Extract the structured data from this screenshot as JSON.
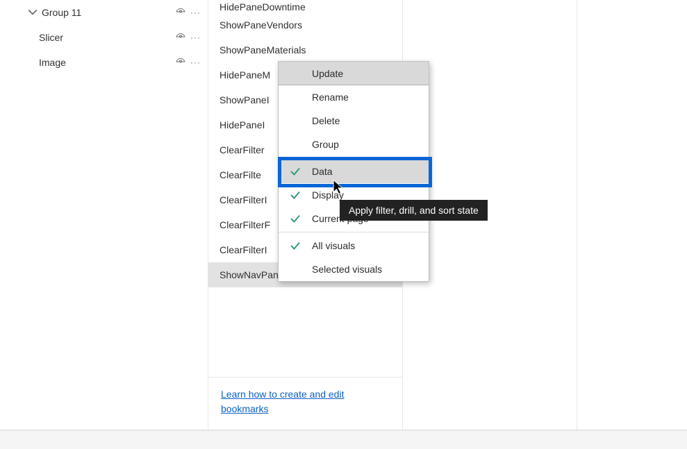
{
  "selection": {
    "items": [
      {
        "label": "Group 11",
        "expanded": true
      },
      {
        "label": "Slicer"
      },
      {
        "label": "Image"
      }
    ]
  },
  "bookmarks": {
    "items": [
      "HidePaneDowntime",
      "ShowPaneVendors",
      "ShowPaneMaterials",
      "HidePaneM",
      "ShowPaneI",
      "HidePaneI",
      "ClearFilter",
      "ClearFilte",
      "ClearFilterI",
      "ClearFilterF",
      "ClearFilterI",
      "ShowNavPanel"
    ],
    "learn_link": "Learn how to create and edit bookmarks"
  },
  "context_menu": {
    "items": [
      {
        "label": "Update"
      },
      {
        "label": "Rename"
      },
      {
        "label": "Delete"
      },
      {
        "label": "Group"
      }
    ],
    "check_items_1": [
      {
        "label": "Data",
        "checked": true,
        "hovered": true
      },
      {
        "label": "Display",
        "checked": true
      },
      {
        "label": "Current page",
        "checked": true
      }
    ],
    "check_items_2": [
      {
        "label": "All visuals",
        "checked": true
      },
      {
        "label": "Selected visuals",
        "checked": false
      }
    ]
  },
  "tooltip": "Apply filter, drill, and sort state"
}
